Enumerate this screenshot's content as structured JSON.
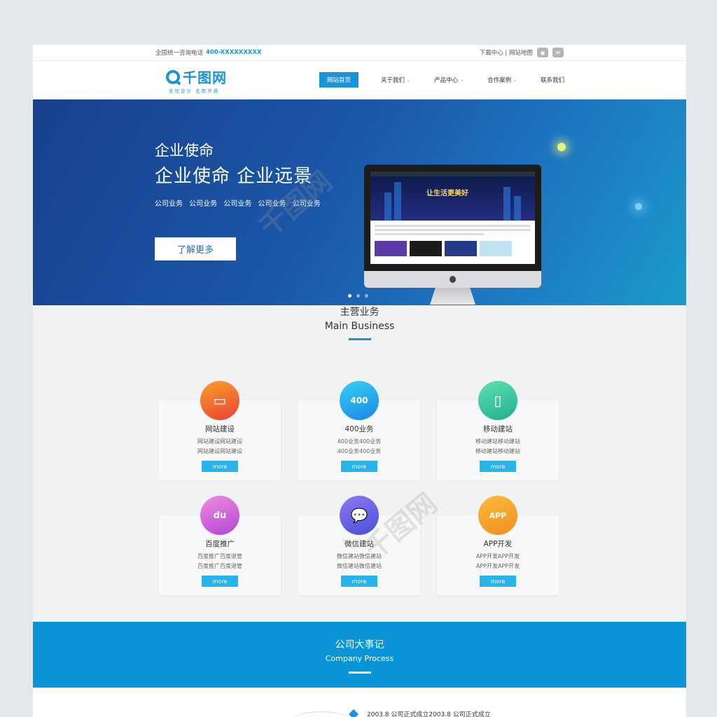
{
  "topbar": {
    "hotline_label": "全国统一咨询电话",
    "hotline_number": "400-XXXXXXXXX",
    "links": "下载中心 | 网站地图"
  },
  "logo": {
    "text": "千图网",
    "slogan": "无忧设计  无限灵感"
  },
  "nav": [
    {
      "label": "网站首页"
    },
    {
      "label": "关于我们"
    },
    {
      "label": "产品中心"
    },
    {
      "label": "合作案例"
    },
    {
      "label": "联系我们"
    }
  ],
  "banner": {
    "title_small": "企业使命",
    "title_big": "企业使命  企业远景",
    "subtitle": "公司业务  公司业务  公司业务  公司业务  公司业务",
    "cta": "了解更多",
    "screen_headline": "让生活更美好"
  },
  "main_business": {
    "title_cn": "主营业务",
    "title_en": "Main Business",
    "cards": [
      {
        "name": "网站建设",
        "d1": "网站建设网站建设",
        "d2": "网站建设网站建设",
        "more": "more",
        "icon": "laptop-icon",
        "color": "#f26b2a"
      },
      {
        "name": "400业务",
        "d1": "400业务400业务",
        "d2": "400业务400业务",
        "more": "more",
        "icon": "phone-400-icon",
        "color": "#1fa6ea",
        "icon_text": "400"
      },
      {
        "name": "移动建站",
        "d1": "移动建站移动建站",
        "d2": "移动建站移动建站",
        "more": "more",
        "icon": "mobile-icon",
        "color": "#2bc08e"
      },
      {
        "name": "百度推广",
        "d1": "百度推广百度退管",
        "d2": "百度推广百度退管",
        "more": "more",
        "icon": "baidu-paw-icon",
        "color": "#cc55d6",
        "icon_text": "du"
      },
      {
        "name": "微信建站",
        "d1": "微信建站微信建站",
        "d2": "微信建站微信建站",
        "more": "more",
        "icon": "wechat-icon",
        "color": "#5b62e0"
      },
      {
        "name": "APP开发",
        "d1": "APP开发APP开发",
        "d2": "APP开发APP开发",
        "more": "more",
        "icon": "app-icon",
        "color": "#f59a2a",
        "icon_text": "APP"
      }
    ]
  },
  "process": {
    "title_cn": "公司大事记",
    "title_en": "Company Process",
    "first_entry": "2003.8  公司正式成立2003.8  公司正式成立"
  },
  "watermark": "千图网"
}
